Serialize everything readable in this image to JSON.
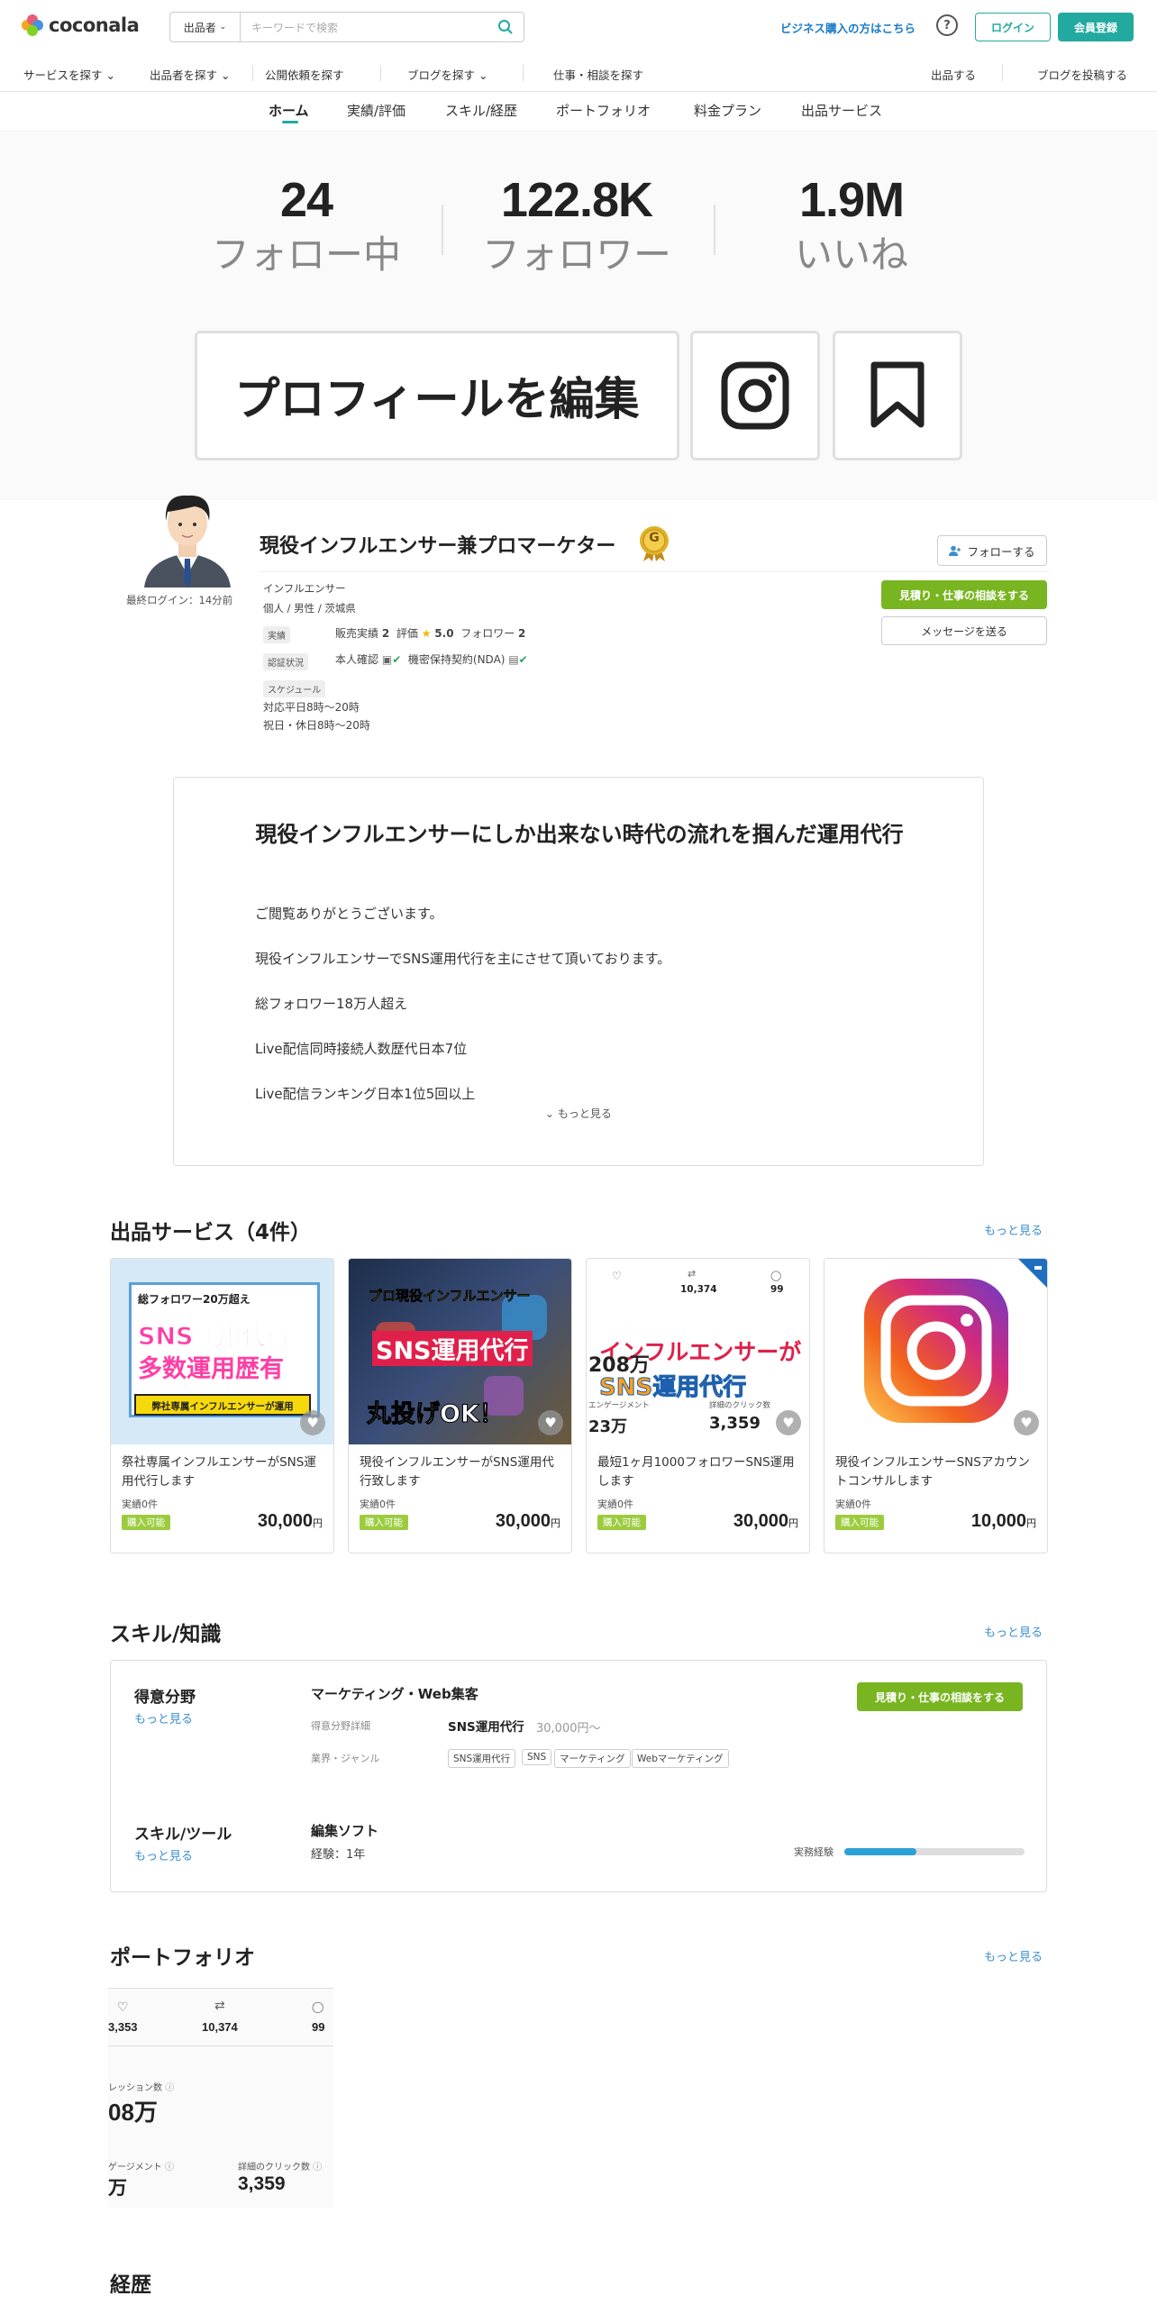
{
  "header": {
    "logo_text": "coconala",
    "search_select": "出品者",
    "search_placeholder": "キーワードで検索",
    "business_link": "ビジネス購入の方はこちら",
    "help_symbol": "?",
    "login": "ログイン",
    "register": "会員登録"
  },
  "nav": {
    "items": [
      "サービスを探す",
      "出品者を探す",
      "公開依頼を探す",
      "ブログを探す",
      "仕事・相談を探す"
    ],
    "right_items": [
      "出品する",
      "ブログを投稿する"
    ]
  },
  "tabs": [
    "ホーム",
    "実績/評価",
    "スキル/経歴",
    "ポートフォリオ",
    "料金プラン",
    "出品サービス"
  ],
  "instagram": {
    "following_count": "24",
    "following_label": "フォロー中",
    "followers_count": "122.8K",
    "followers_label": "フォロワー",
    "likes_count": "1.9M",
    "likes_label": "いいね",
    "edit_profile": "プロフィールを編集"
  },
  "profile": {
    "last_login": "最終ログイン：14分前",
    "name": "現役インフルエンサー兼プロマーケター",
    "rank_badge": "G",
    "category": "インフルエンサー",
    "attributes": "個人 / 男性 / 茨城県",
    "achievement_chip": "実績",
    "sales_label": "販売実績",
    "sales_value": "2",
    "rating_label": "評価",
    "rating_value": "5.0",
    "follower_label": "フォロワー",
    "follower_value": "2",
    "verify_chip": "認証状況",
    "identity": "本人確認",
    "nda": "機密保持契約(NDA)",
    "schedule_chip": "スケジュール",
    "weekday": "対応平日8時〜20時",
    "holiday": "祝日・休日8時〜20時",
    "follow_button": "フォローする",
    "consult_button": "見積り・仕事の相談をする",
    "message_button": "メッセージを送る"
  },
  "intro": {
    "title": "現役インフルエンサーにしか出来ない時代の流れを掴んだ運用代行",
    "paragraphs": [
      "ご閲覧ありがとうございます。",
      "現役インフルエンサーでSNS運用代行を主にさせて頂いております。",
      "総フォロワー18万人超え",
      " Live配信同時接続人数歴代日本7位",
      " Live配信ランキング日本1位5回以上"
    ],
    "more": "もっと見る"
  },
  "services": {
    "title": "出品サービス（4件）",
    "more": "もっと見る",
    "items": [
      {
        "title": "祭社専属インフルエンサーがSNS運用代行します",
        "achievements": "実績0件",
        "tag": "購入可能",
        "price": "30,000",
        "unit": "円",
        "thumb": {
          "line1": "総フォロワー20万超え",
          "line2": "SNS運用代行",
          "line3": "多数運用歴有",
          "line4": "弊社専属インフルエンサーが運用"
        }
      },
      {
        "title": "現役インフルエンサーがSNS運用代行致します",
        "achievements": "実績0件",
        "tag": "購入可能",
        "price": "30,000",
        "unit": "円",
        "thumb": {
          "line1": "プロ現役インフルエンサー",
          "line2": "SNS運用代行",
          "line3": "丸投げOK！"
        }
      },
      {
        "title": "最短1ヶ月1000フォロワーSNS運用します",
        "achievements": "実績0件",
        "tag": "購入可能",
        "price": "30,000",
        "unit": "円",
        "thumb": {
          "retweets": "10,374",
          "comments": "99",
          "line1": "現役",
          "line2": "インフルエンサーが",
          "line3": "SNS運用代行",
          "big": "208万",
          "small1": "23万",
          "small2": "3,359",
          "lbl1": "エンゲージメント",
          "lbl2": "詳細のクリック数"
        }
      },
      {
        "title": "現役インフルエンサーSNSアカウントコンサルします",
        "achievements": "実績0件",
        "tag": "購入可能",
        "price": "10,000",
        "unit": "円"
      }
    ]
  },
  "skills": {
    "title": "スキル/知識",
    "more": "もっと見る",
    "specialty_label": "得意分野",
    "specialty_more": "もっと見る",
    "specialty_name": "マーケティング・Web集客",
    "detail_label": "得意分野詳細",
    "detail_value": "SNS運用代行",
    "detail_price": "30,000円〜",
    "genre_label": "業界・ジャンル",
    "genres": [
      "SNS運用代行",
      "SNS",
      "マーケティング",
      "Webマーケティング"
    ],
    "consult_button": "見積り・仕事の相談をする",
    "tools_label": "スキル/ツール",
    "tools_more": "もっと見る",
    "tool_name": "編集ソフト",
    "tool_exp": "経験：1年",
    "practical_label": "実務経験",
    "practical_level": 0.4
  },
  "portfolio": {
    "title": "ポートフォリオ",
    "more": "もっと見る",
    "likes": "3,353",
    "retweets": "10,374",
    "comments": "99",
    "impressions_label": "レッション数",
    "impressions": "08万",
    "engagement_label": "ゲージメント",
    "engagement": "万",
    "clicks_label": "詳細のクリック数",
    "clicks": "3,359"
  },
  "career": {
    "title": "経歴"
  },
  "colors": {
    "teal": "#23aaa0",
    "green": "#78b520",
    "link": "#3a8fcf",
    "gold": "#e0b22a"
  }
}
